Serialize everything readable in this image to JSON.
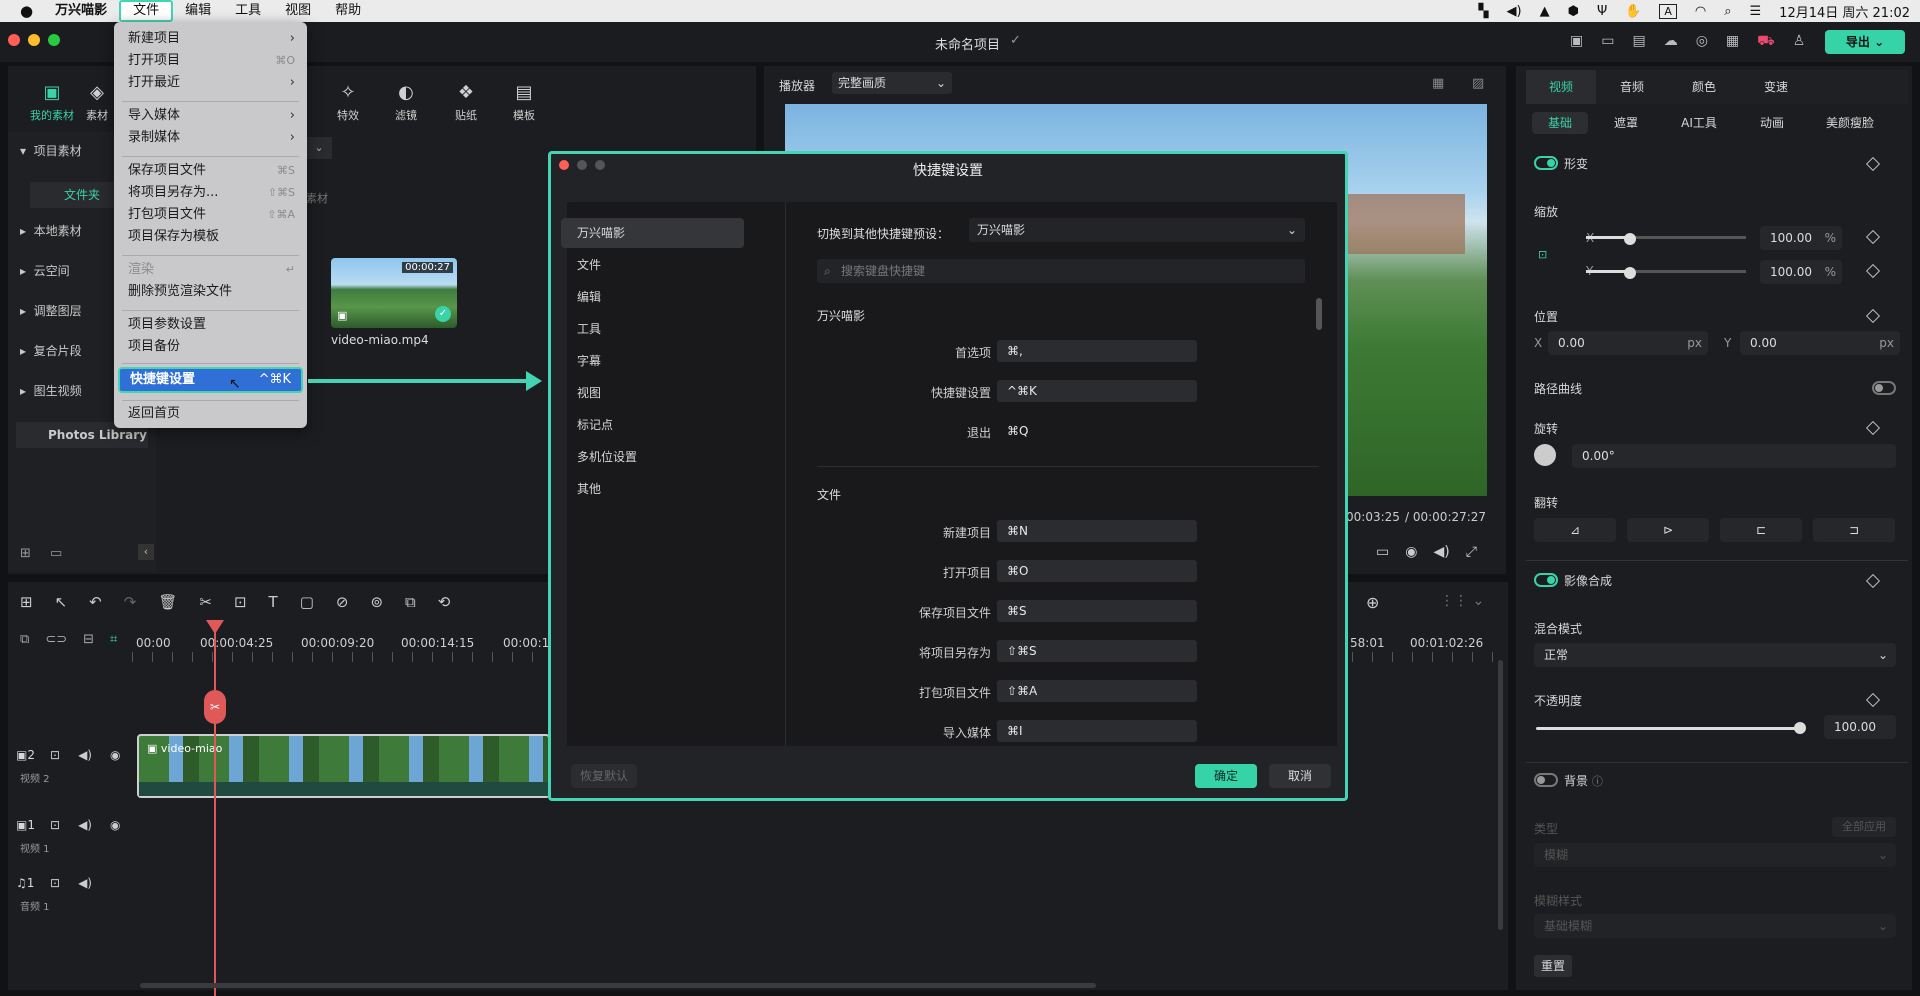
{
  "menubar": {
    "apple": "",
    "app": "万兴喵影",
    "items": [
      "文件",
      "编辑",
      "工具",
      "视图",
      "帮助"
    ],
    "right": {
      "input": "A",
      "datetime": "12月14日 周六 21:02"
    }
  },
  "app": {
    "project_title": "未命名项目",
    "export_label": "导出"
  },
  "toolbar": {
    "tools": [
      {
        "label": "我的素材",
        "icon": "media-icon"
      },
      {
        "label": "素材",
        "icon": "stock-icon"
      },
      {
        "label": "特效",
        "icon": "effects-icon"
      },
      {
        "label": "滤镜",
        "icon": "filter-icon"
      },
      {
        "label": "贴纸",
        "icon": "sticker-icon"
      },
      {
        "label": "模板",
        "icon": "template-icon"
      }
    ]
  },
  "sidebar": {
    "items": [
      "项目素材",
      "文件夹",
      "本地素材",
      "云空间",
      "调整图层",
      "复合片段",
      "图生视频",
      "Photos Library"
    ]
  },
  "media": {
    "section": "素材",
    "clip_name": "video-miao.mp4",
    "clip_duration": "00:00:27"
  },
  "file_menu": {
    "items": [
      {
        "label": "新建项目",
        "shortcut": "›"
      },
      {
        "label": "打开项目",
        "shortcut": "⌘O"
      },
      {
        "label": "打开最近",
        "shortcut": "›"
      },
      {
        "label": "导入媒体",
        "shortcut": "›"
      },
      {
        "label": "录制媒体",
        "shortcut": "›"
      },
      {
        "label": "保存项目文件",
        "shortcut": "⌘S"
      },
      {
        "label": "将项目另存为...",
        "shortcut": "⇧⌘S"
      },
      {
        "label": "打包项目文件",
        "shortcut": "⇧⌘A"
      },
      {
        "label": "项目保存为模板",
        "shortcut": ""
      },
      {
        "label": "渲染",
        "shortcut": "↵"
      },
      {
        "label": "删除预览渲染文件",
        "shortcut": ""
      },
      {
        "label": "项目参数设置",
        "shortcut": ""
      },
      {
        "label": "项目备份",
        "shortcut": ""
      },
      {
        "label": "快捷键设置",
        "shortcut": "^⌘K"
      },
      {
        "label": "返回首页",
        "shortcut": ""
      }
    ]
  },
  "dialog": {
    "title": "快捷键设置",
    "nav": [
      "万兴喵影",
      "文件",
      "编辑",
      "工具",
      "字幕",
      "视图",
      "标记点",
      "多机位设置",
      "其他"
    ],
    "preset_label": "切换到其他快捷键预设：",
    "preset_value": "万兴喵影",
    "search_placeholder": "搜索键盘快捷键",
    "section1": "万兴喵影",
    "rows1": [
      {
        "label": "首选项",
        "key": "⌘,"
      },
      {
        "label": "快捷键设置",
        "key": "^⌘K"
      },
      {
        "label": "退出",
        "key": "⌘Q"
      }
    ],
    "section2": "文件",
    "rows2": [
      {
        "label": "新建项目",
        "key": "⌘N"
      },
      {
        "label": "打开项目",
        "key": "⌘O"
      },
      {
        "label": "保存项目文件",
        "key": "⌘S"
      },
      {
        "label": "将项目另存为",
        "key": "⇧⌘S"
      },
      {
        "label": "打包项目文件",
        "key": "⇧⌘A"
      },
      {
        "label": "导入媒体",
        "key": "⌘I"
      }
    ],
    "restore": "恢复默认",
    "ok": "确定",
    "cancel": "取消"
  },
  "player": {
    "label": "播放器",
    "quality": "完整画质",
    "current": "00:03:25",
    "total": "/ 00:00:27:27"
  },
  "inspector": {
    "tabs": [
      "视频",
      "音频",
      "颜色",
      "变速"
    ],
    "subtabs": [
      "基础",
      "遮罩",
      "AI工具",
      "动画",
      "美颜瘦脸"
    ],
    "transform": "形变",
    "scale": "缩放",
    "x": "X",
    "y": "Y",
    "scale_x": "100.00",
    "scale_y": "100.00",
    "pct": "%",
    "position": "位置",
    "pos_x": "0.00",
    "pos_y": "0.00",
    "px": "px",
    "path_curve": "路径曲线",
    "rotate": "旋转",
    "rotate_val": "0.00°",
    "flip": "翻转",
    "compositing": "影像合成",
    "blend_mode": "混合模式",
    "blend_val": "正常",
    "opacity": "不透明度",
    "opacity_val": "100.00",
    "background": "背景",
    "type": "类型",
    "apply_all": "全部应用",
    "type_val": "模糊",
    "blur_style": "模糊样式",
    "blur_val": "基础模糊",
    "reset": "重置"
  },
  "timeline": {
    "ticks": [
      "00:00",
      "00:00:04:25",
      "00:00:09:20",
      "00:00:14:15",
      "00:00:1",
      "58:01",
      "00:01:02:26"
    ],
    "tracks": [
      {
        "num": "2",
        "name": "视频 2"
      },
      {
        "num": "1",
        "name": "视频 1"
      },
      {
        "num": "1",
        "name": "音频 1"
      }
    ],
    "clip_label": "video-miao"
  }
}
